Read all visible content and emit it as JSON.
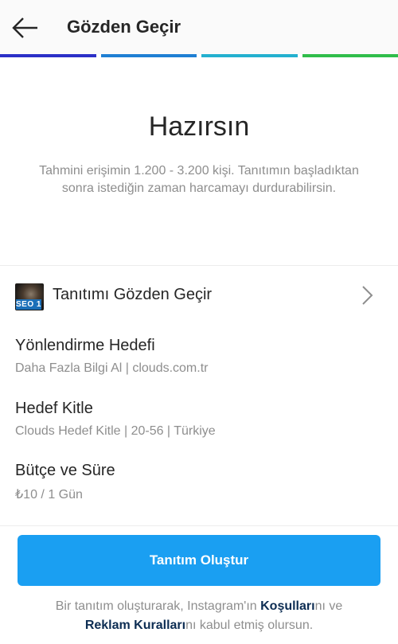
{
  "header": {
    "title": "Gözden Geçir"
  },
  "progress": {
    "colors": [
      "#2b2fc7",
      "#1f7fd3",
      "#23b0cf",
      "#2fbd4a"
    ]
  },
  "hero": {
    "title": "Hazırsın",
    "description": "Tahmini erişimin 1.200 - 3.200 kişi. Tanıtımın başladıktan sonra istediğin zaman harcamayı durdurabilirsin."
  },
  "review": {
    "label": "Tanıtımı Gözden Geçir",
    "thumb_text": "SEO 1"
  },
  "fields": [
    {
      "label": "Yönlendirme Hedefi",
      "value": "Daha Fazla Bilgi Al | clouds.com.tr"
    },
    {
      "label": "Hedef Kitle",
      "value": "Clouds Hedef Kitle | 20-56 | Türkiye"
    },
    {
      "label": "Bütçe ve Süre",
      "value": "₺10 / 1 Gün"
    }
  ],
  "cta": {
    "label": "Tanıtım Oluştur"
  },
  "terms": {
    "part1": "Bir tanıtım oluşturarak, Instagram'ın ",
    "link1": "Koşulları",
    "part2": "nı ve ",
    "link2": "Reklam Kuralları",
    "part3": "nı kabul etmiş olursun."
  }
}
